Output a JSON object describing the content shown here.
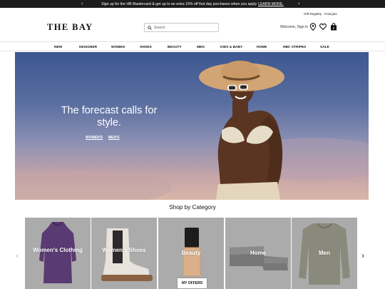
{
  "promo": {
    "text": "Sign up for the HB Mastercard & get up to an extra 15% off first day purchases when you apply",
    "link": "LEARN MORE."
  },
  "utility": {
    "gift_registry": "Gift Registry",
    "language": "Français"
  },
  "header": {
    "logo": "THE BAY",
    "search_placeholder": "Search",
    "welcome": "Welcome, Sign In",
    "icons": [
      "search-icon",
      "location-pin-icon",
      "heart-icon",
      "shopping-bag-icon"
    ],
    "bag_count": "0"
  },
  "nav": [
    "NEW",
    "DESIGNER",
    "WOMEN",
    "SHOES",
    "BEAUTY",
    "MEN",
    "KIDS & BABY",
    "HOME",
    "HBC STRIPES",
    "SALE"
  ],
  "hero": {
    "title": "The forecast calls for style.",
    "links": [
      "WOMEN'S",
      "MEN'S"
    ]
  },
  "categories": {
    "heading": "Shop by Category",
    "tiles": [
      "Women's Clothing",
      "Women's Shoes",
      "Beauty",
      "Home",
      "Men"
    ]
  },
  "offers_button": "MY OFFERS",
  "colors": {
    "promo_bg": "#1c1c1c",
    "tile_bg": "#ababab",
    "hero_sky": "#4a619b"
  }
}
